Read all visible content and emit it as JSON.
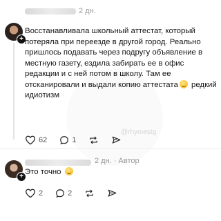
{
  "comments": [
    {
      "time": "2 дн.",
      "author_tag": "",
      "text": "Восстанавливала школьный аттестат, который потеряла при переезде в другой город. Реально пришлось подавать через подругу объявление в местную газету, ездила забирать ее в офис редакции и с ней потом в школу. Там ее отсканировали и выдали копию аттестата",
      "text_after_emoji": "редкий идиотизм",
      "likes": "62",
      "replies": "1"
    },
    {
      "time": "2 дн. · Автор",
      "text": "Это точно",
      "likes": "2",
      "replies": "2"
    }
  ],
  "watermark": "@rhymestg",
  "icons": [
    "plus-icon",
    "heart-icon",
    "comment-icon",
    "repost-icon",
    "share-icon",
    "smile-emoji-icon"
  ]
}
